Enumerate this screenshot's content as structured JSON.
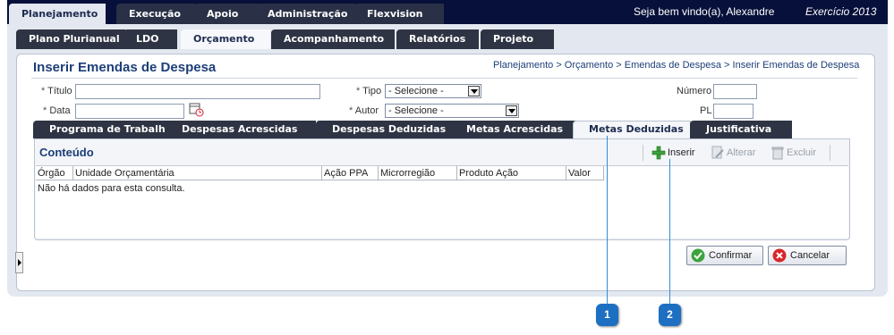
{
  "header": {
    "main_tabs": [
      {
        "label": "Planejamento",
        "active": true
      },
      {
        "label": "Execução",
        "active": false
      },
      {
        "label": "Apoio",
        "active": false
      },
      {
        "label": "Administração",
        "active": false
      },
      {
        "label": "Flexvision",
        "active": false
      }
    ],
    "welcome": "Seja bem vindo(a), Alexandre",
    "exercise": "Exercício 2013"
  },
  "subnav": {
    "tabs": [
      {
        "label": "Plano Plurianual",
        "active": false
      },
      {
        "label": "LDO",
        "active": false
      },
      {
        "label": "Orçamento",
        "active": true
      },
      {
        "label": "Acompanhamento",
        "active": false
      },
      {
        "label": "Relatórios",
        "active": false
      },
      {
        "label": "Projeto",
        "active": false
      }
    ]
  },
  "page": {
    "title": "Inserir Emendas de Despesa",
    "breadcrumb": "Planejamento > Orçamento > Emendas de Despesa > Inserir Emendas de Despesa"
  },
  "form": {
    "titulo_label": "Título",
    "data_label": "Data",
    "tipo_label": "Tipo",
    "tipo_value": "- Selecione -",
    "autor_label": "Autor",
    "autor_value": "- Selecione -",
    "numero_label": "Número",
    "pl_label": "PL",
    "required_marker": "*"
  },
  "inner_tabs": [
    {
      "label": "Programa de Trabalho",
      "active": false
    },
    {
      "label": "Despesas Acrescidas",
      "active": false
    },
    {
      "label": "Despesas Deduzidas",
      "active": false
    },
    {
      "label": "Metas Acrescidas",
      "active": false
    },
    {
      "label": "Metas Deduzidas",
      "active": true
    },
    {
      "label": "Justificativa",
      "active": false
    }
  ],
  "content": {
    "title": "Conteúdo",
    "toolbar": {
      "insert": "Inserir",
      "edit": "Alterar",
      "delete": "Excluir"
    },
    "columns": [
      "Órgão",
      "Unidade Orçamentária",
      "Ação PPA",
      "Microrregião",
      "Produto Ação",
      "Valor"
    ],
    "empty_message": "Não há dados para esta consulta."
  },
  "actions": {
    "confirm": "Confirmar",
    "cancel": "Cancelar"
  },
  "callouts": [
    "1",
    "2"
  ],
  "colors": {
    "topbar": "#06103a",
    "tab_dark": "#2e3443",
    "frame": "#e3e8f0",
    "title_blue": "#1c3f78",
    "callout": "#1d6fc2"
  }
}
